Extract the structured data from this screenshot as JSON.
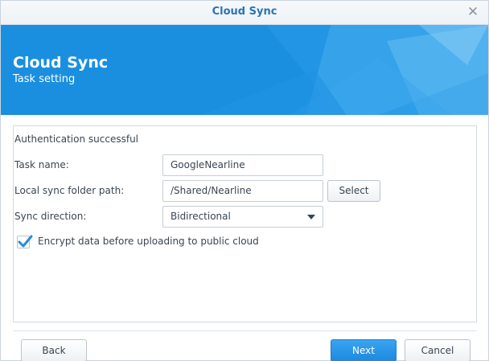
{
  "window": {
    "title": "Cloud Sync",
    "close_icon": "close-icon"
  },
  "banner": {
    "title": "Cloud Sync",
    "subtitle": "Task setting",
    "color": "#1a8fe0"
  },
  "form": {
    "status": "Authentication successful",
    "task_name_label": "Task name:",
    "task_name_value": "GoogleNearline",
    "local_path_label": "Local sync folder path:",
    "local_path_value": "/Shared/Nearline",
    "select_label": "Select",
    "sync_direction_label": "Sync direction:",
    "sync_direction_value": "Bidirectional",
    "encrypt_label": "Encrypt data before uploading to public cloud",
    "encrypt_checked": true
  },
  "footer": {
    "back_label": "Back",
    "next_label": "Next",
    "cancel_label": "Cancel"
  },
  "colors": {
    "accent": "#1d8ae0",
    "title_text": "#2a73b8",
    "check": "#2b8ad8"
  }
}
